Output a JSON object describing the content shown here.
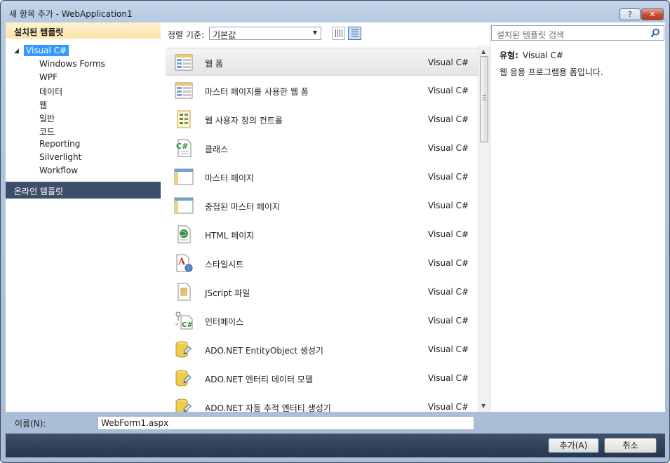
{
  "window": {
    "title": "새 항목 추가 - WebApplication1",
    "help_label": "?",
    "close_label": "✕"
  },
  "left": {
    "header": "설치된 템플릿",
    "root": "Visual C#",
    "items": [
      "Windows Forms",
      "WPF",
      "데이터",
      "웹",
      "일반",
      "코드",
      "Reporting",
      "Silverlight",
      "Workflow"
    ],
    "online": "온라인 템플릿"
  },
  "toolbar": {
    "sort_label": "정렬 기준:",
    "sort_value": "기본값"
  },
  "templates": [
    {
      "name": "웹 폼",
      "lang": "Visual C#",
      "icon": "web-form-icon",
      "selected": true
    },
    {
      "name": "마스터 페이지를 사용한 웹 폼",
      "lang": "Visual C#",
      "icon": "web-form-icon"
    },
    {
      "name": "웹 사용자 정의 컨트롤",
      "lang": "Visual C#",
      "icon": "user-control-icon"
    },
    {
      "name": "클래스",
      "lang": "Visual C#",
      "icon": "class-icon"
    },
    {
      "name": "마스터 페이지",
      "lang": "Visual C#",
      "icon": "master-page-icon"
    },
    {
      "name": "중첩된 마스터 페이지",
      "lang": "Visual C#",
      "icon": "master-page-icon"
    },
    {
      "name": "HTML 페이지",
      "lang": "Visual C#",
      "icon": "html-page-icon"
    },
    {
      "name": "스타일시트",
      "lang": "Visual C#",
      "icon": "stylesheet-icon"
    },
    {
      "name": "JScript 파일",
      "lang": "Visual C#",
      "icon": "jscript-icon"
    },
    {
      "name": "인터페이스",
      "lang": "Visual C#",
      "icon": "interface-icon"
    },
    {
      "name": "ADO.NET EntityObject 생성기",
      "lang": "Visual C#",
      "icon": "database-icon"
    },
    {
      "name": "ADO.NET 엔터티 데이터 모델",
      "lang": "Visual C#",
      "icon": "database-icon"
    },
    {
      "name": "ADO.NET 자동 추적 엔터티 생성기",
      "lang": "Visual C#",
      "icon": "database-icon"
    }
  ],
  "right": {
    "search_placeholder": "설치된 템플릿 검색",
    "type_label": "유형:",
    "type_value": "Visual C#",
    "description": "웹 응용 프로그램용 폼입니다."
  },
  "bottom": {
    "name_label": "이름(N):",
    "name_value": "WebForm1.aspx",
    "add_label": "추가(A)",
    "cancel_label": "취소"
  }
}
